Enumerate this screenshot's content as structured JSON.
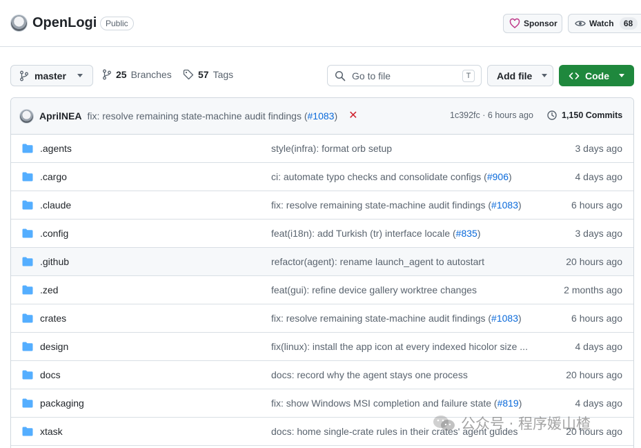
{
  "repo": {
    "name": "OpenLogi",
    "visibility": "Public",
    "sponsor_label": "Sponsor",
    "watch_label": "Watch",
    "watch_count": "68"
  },
  "toolbar": {
    "branch": "master",
    "branches_count": "25",
    "branches_label": "Branches",
    "tags_count": "57",
    "tags_label": "Tags",
    "goto_placeholder": "Go to file",
    "goto_shortcut": "T",
    "add_file_label": "Add file",
    "code_label": "Code"
  },
  "latest_commit": {
    "author": "AprilNEA",
    "message": "fix: resolve remaining state-machine audit findings (",
    "pr": "#1083",
    "message_end": ")",
    "hash_age": "1c392fc · 6 hours ago",
    "commits_count": "1,150 Commits"
  },
  "files": [
    {
      "name": ".agents",
      "msg": "style(infra): format orb setup",
      "pr": "",
      "tail": "",
      "age": "3 days ago"
    },
    {
      "name": ".cargo",
      "msg": "ci: automate typo checks and consolidate configs (",
      "pr": "#906",
      "tail": ")",
      "age": "4 days ago"
    },
    {
      "name": ".claude",
      "msg": "fix: resolve remaining state-machine audit findings (",
      "pr": "#1083",
      "tail": ")",
      "age": "6 hours ago"
    },
    {
      "name": ".config",
      "msg": "feat(i18n): add Turkish (tr) interface locale (",
      "pr": "#835",
      "tail": ")",
      "age": "3 days ago"
    },
    {
      "name": ".github",
      "msg": "refactor(agent): rename launch_agent to autostart",
      "pr": "",
      "tail": "",
      "age": "20 hours ago"
    },
    {
      "name": ".zed",
      "msg": "feat(gui): refine device gallery worktree changes",
      "pr": "",
      "tail": "",
      "age": "2 months ago"
    },
    {
      "name": "crates",
      "msg": "fix: resolve remaining state-machine audit findings (",
      "pr": "#1083",
      "tail": ")",
      "age": "6 hours ago"
    },
    {
      "name": "design",
      "msg": "fix(linux): install the app icon at every indexed hicolor size ...",
      "pr": "",
      "tail": "",
      "age": "4 days ago"
    },
    {
      "name": "docs",
      "msg": "docs: record why the agent stays one process",
      "pr": "",
      "tail": "",
      "age": "20 hours ago"
    },
    {
      "name": "packaging",
      "msg": "fix: show Windows MSI completion and failure state (",
      "pr": "#819",
      "tail": ")",
      "age": "4 days ago"
    },
    {
      "name": "xtask",
      "msg": "docs: home single-crate rules in their crates' agent guides",
      "pr": "",
      "tail": "",
      "age": "20 hours ago"
    }
  ],
  "watermark": "公众号 · 程序媛山楂",
  "colors": {
    "accent": "#0969da",
    "code_button": "#1f883d",
    "folder": "#54aeff",
    "fail": "#cf222e"
  }
}
